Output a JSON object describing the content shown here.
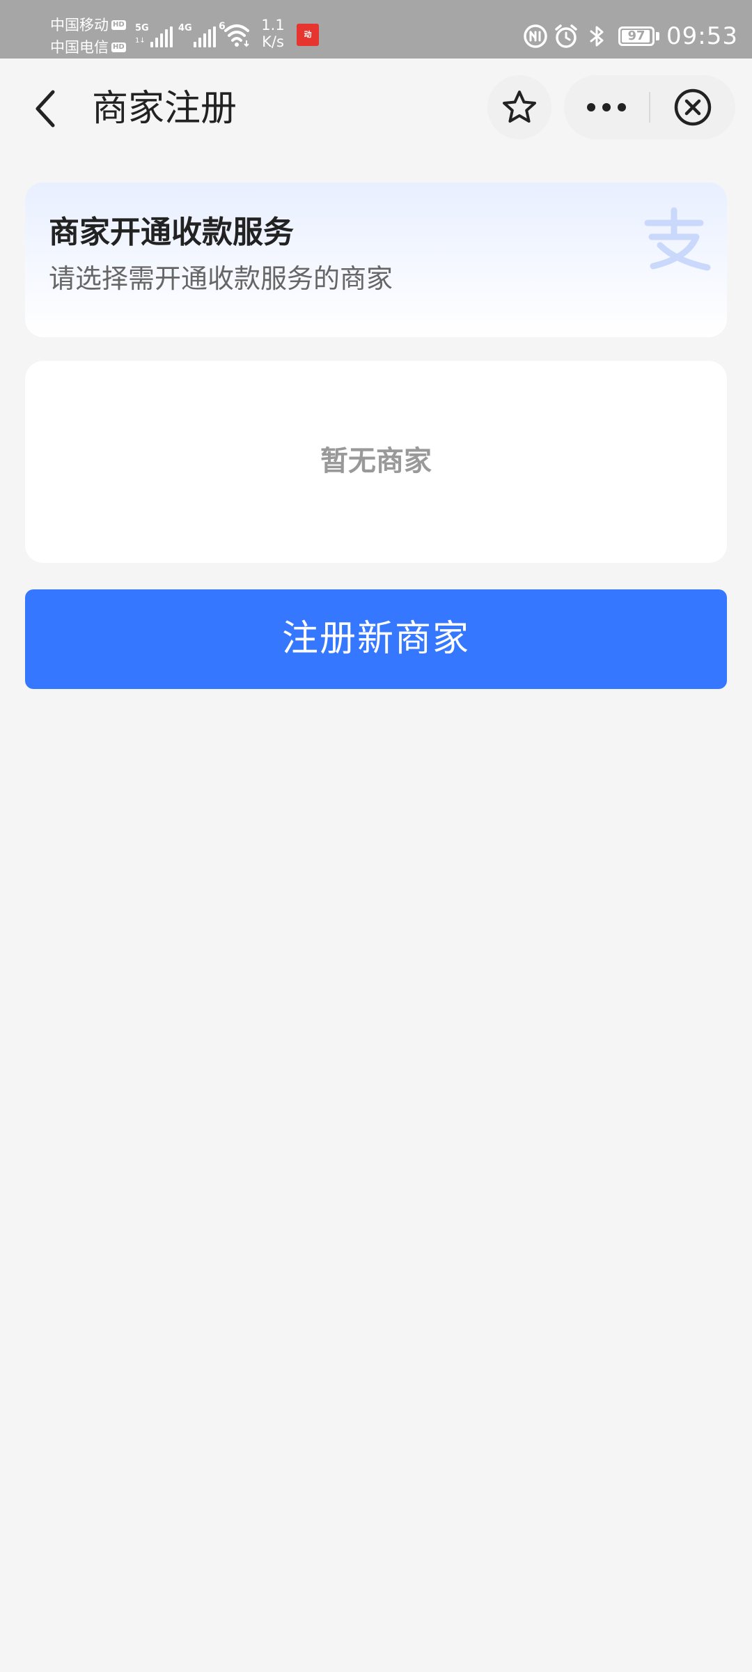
{
  "status_bar": {
    "carrier_1": "中国移动",
    "carrier_2": "中国电信",
    "hd_label": "HD",
    "sim1_network": "5G",
    "sim1_sub": "1↓",
    "sim2_network": "4G",
    "wifi_band": "6",
    "speed_value": "1.1",
    "speed_unit": "K/s",
    "notification_app_icon": "app-notification-icon",
    "battery_level": "97",
    "time": "09:53",
    "icons": [
      "nfc-icon",
      "alarm-icon",
      "bluetooth-icon",
      "battery-icon"
    ]
  },
  "header": {
    "back_icon": "chevron-left-icon",
    "title": "商家注册",
    "favorite_icon": "star-icon",
    "more_icon": "more-dots-icon",
    "close_icon": "close-circle-icon"
  },
  "intro": {
    "title": "商家开通收款服务",
    "subtitle": "请选择需开通收款服务的商家",
    "watermark_icon": "alipay-logo-icon"
  },
  "merchants": {
    "empty_text": "暂无商家"
  },
  "actions": {
    "register_label": "注册新商家"
  },
  "colors": {
    "status_bar_bg": "#a6a6a6",
    "page_bg": "#f5f5f5",
    "primary_button": "#3578ff",
    "empty_text": "#999999",
    "banner_gradient_top": "#e8efff"
  }
}
